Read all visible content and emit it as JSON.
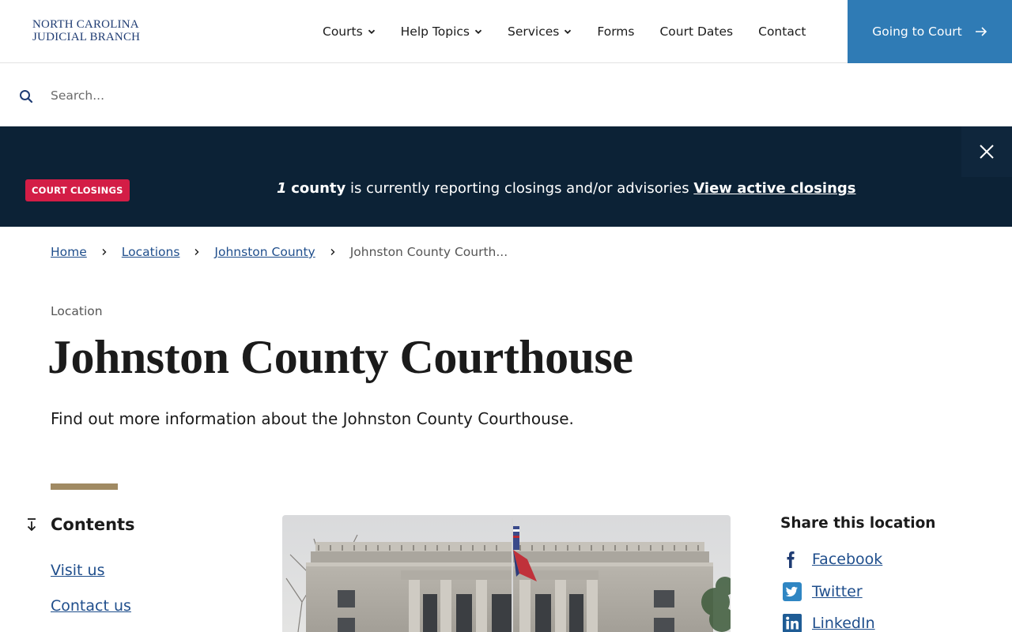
{
  "header": {
    "logo_line1": "NORTH CAROLINA",
    "logo_line2": "JUDICIAL BRANCH",
    "nav": [
      {
        "label": "Courts",
        "dropdown": true
      },
      {
        "label": "Help Topics",
        "dropdown": true
      },
      {
        "label": "Services",
        "dropdown": true
      },
      {
        "label": "Forms",
        "dropdown": false
      },
      {
        "label": "Court Dates",
        "dropdown": false
      },
      {
        "label": "Contact",
        "dropdown": false
      }
    ],
    "cta_label": "Going to Court"
  },
  "search": {
    "placeholder": "Search..."
  },
  "alert": {
    "badge": "COURT CLOSINGS",
    "count": "1",
    "county_word": "county",
    "message": " is currently reporting closings and/or advisories ",
    "link": "View active closings"
  },
  "breadcrumb": {
    "items": [
      "Home",
      "Locations",
      "Johnston County"
    ],
    "current": "Johnston County Courth..."
  },
  "page": {
    "eyebrow": "Location",
    "title": "Johnston County Courthouse",
    "description": "Find out more information about the Johnston County Courthouse."
  },
  "contents": {
    "title": "Contents",
    "links": [
      "Visit us",
      "Contact us"
    ]
  },
  "share": {
    "title": "Share this location",
    "links": [
      "Facebook",
      "Twitter",
      "LinkedIn"
    ]
  },
  "colors": {
    "primary_blue": "#2f7bb5",
    "alert_bg": "#0c2236",
    "badge_red": "#d31d46",
    "link_blue": "#1f4e8c",
    "gold": "#a08a63"
  }
}
